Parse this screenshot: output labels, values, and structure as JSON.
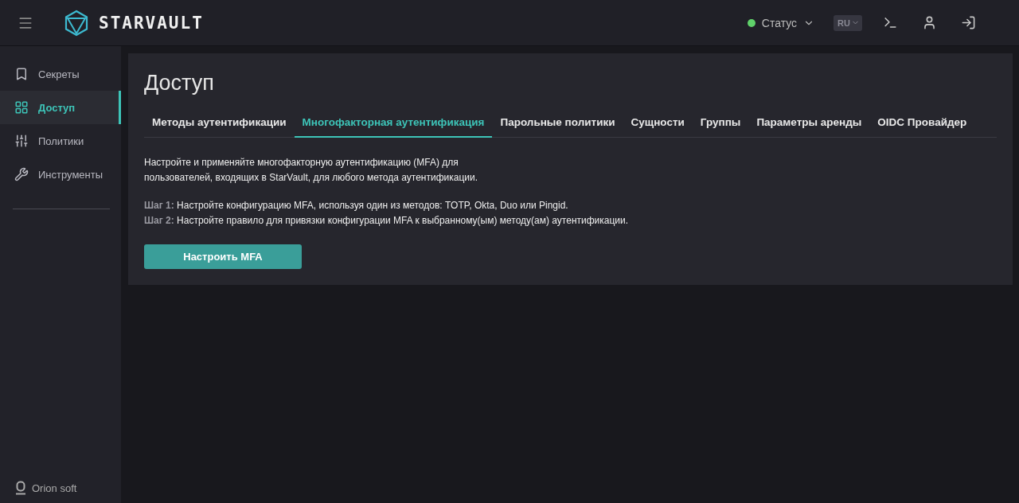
{
  "header": {
    "logo": "STARVAULT",
    "status": {
      "label": "Статус",
      "color": "#5fd16a"
    },
    "language": "RU"
  },
  "sidebar": {
    "items": [
      {
        "label": "Секреты",
        "kind": "secrets",
        "selected": false
      },
      {
        "label": "Доступ",
        "kind": "access",
        "selected": true
      },
      {
        "label": "Политики",
        "kind": "policies",
        "selected": false
      },
      {
        "label": "Инструменты",
        "kind": "tools",
        "selected": false
      }
    ],
    "footer": "Orion soft"
  },
  "page": {
    "title": "Доступ",
    "tabs": [
      {
        "label": "Методы аутентификации",
        "selected": false
      },
      {
        "label": "Многофакторная аутентификация",
        "selected": true
      },
      {
        "label": "Парольные политики",
        "selected": false
      },
      {
        "label": "Сущности",
        "selected": false
      },
      {
        "label": "Группы",
        "selected": false
      },
      {
        "label": "Параметры аренды",
        "selected": false
      },
      {
        "label": "OIDC Провайдер",
        "selected": false
      }
    ],
    "description": "Настройте и применяйте многофакторную аутентификацию (MFA) для пользователей, входящих в StarVault, для любого метода аутентификации.",
    "steps": [
      {
        "label": "Шаг 1:",
        "text": "Настройте конфигурацию MFA, используя один из методов: TOTP, Okta, Duo или Pingid."
      },
      {
        "label": "Шаг 2:",
        "text": "Настройте правило для привязки конфигурации MFA к выбранному(ым) методу(ам) аутентификации."
      }
    ],
    "button": "Настроить MFA"
  }
}
